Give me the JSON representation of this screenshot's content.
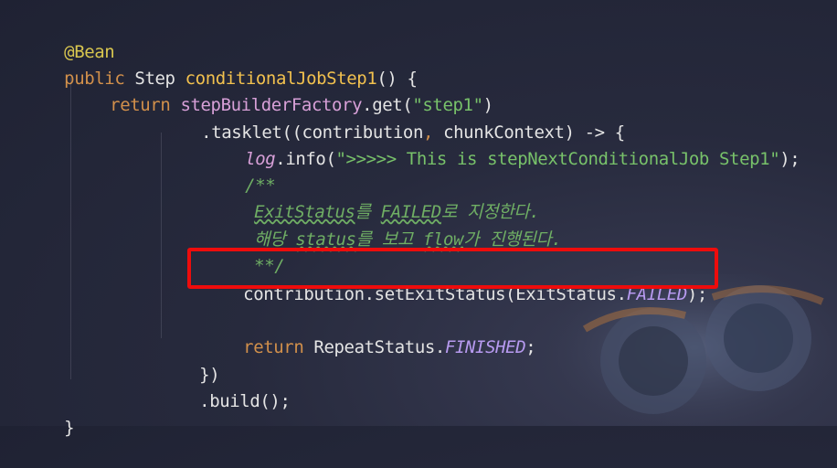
{
  "code": {
    "l1": {
      "annotation": "@Bean"
    },
    "l2": {
      "kw": "public",
      "type": " Step ",
      "name": "conditionalJobStep1",
      "rest": "() {"
    },
    "l3": {
      "kw": "return",
      "sp": " ",
      "factory": "stepBuilderFactory",
      "dot": ".",
      "get": "get",
      "open": "(",
      "arg": "\"step1\"",
      "close": ")"
    },
    "l4": {
      "pre": ".tasklet((contribution",
      "comma": ",",
      "post": " chunkContext) -> {"
    },
    "l5": {
      "log": "log",
      "info": ".info(",
      "str": "\">>>>> This is stepNextConditionalJob Step1\"",
      "end": ");"
    },
    "l6": {
      "text": "/**"
    },
    "l7": {
      "w1": "ExitStatus",
      "t1": "를 ",
      "w2": "FAILED",
      "t2": "로 지정한다."
    },
    "l8": {
      "t1": "해당 ",
      "w1": "status",
      "t2": "를 보고 ",
      "w2": "flow",
      "t3": "가 진행된다."
    },
    "l9": {
      "text": "**/"
    },
    "l10": {
      "pre": "contribution.setExitStatus(ExitStatus.",
      "field": "FAILED",
      "end": ");"
    },
    "l11": {
      "kw": "return",
      "mid": " RepeatStatus.",
      "field": "FINISHED",
      "end": ";"
    },
    "l12": {
      "text": "})"
    },
    "l13": {
      "text": ".build();"
    },
    "l14": {
      "text": "}"
    }
  },
  "colors": {
    "background": "#272a3d",
    "annotation": "#d8c64f",
    "keyword": "#d2904b",
    "method_name": "#f2c14e",
    "string": "#78c26a",
    "comment": "#6fae64",
    "constant": "#b79af0",
    "highlight_border": "#ee0c0c"
  }
}
